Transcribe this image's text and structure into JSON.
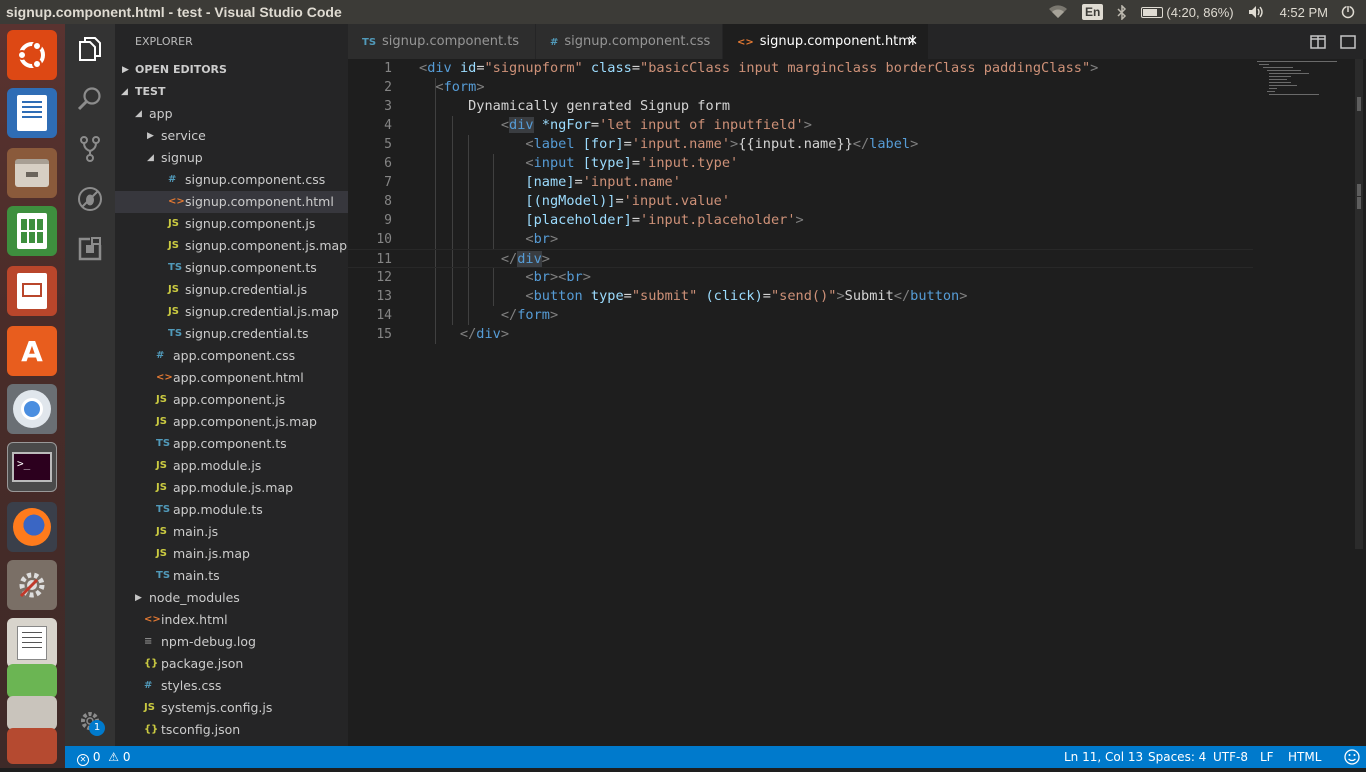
{
  "window": {
    "title": "signup.component.html - test - Visual Studio Code"
  },
  "tray": {
    "lang": "En",
    "battery": "(4:20, 86%)",
    "clock": "4:52 PM"
  },
  "sidebar": {
    "title": "EXPLORER",
    "open_editors": "OPEN EDITORS",
    "project": "TEST",
    "tree": [
      {
        "name": "app",
        "type": "folder-open",
        "depth": 1
      },
      {
        "name": "service",
        "type": "folder",
        "depth": 2
      },
      {
        "name": "signup",
        "type": "folder-open",
        "depth": 2
      },
      {
        "name": "signup.component.css",
        "type": "css",
        "depth": 3
      },
      {
        "name": "signup.component.html",
        "type": "html",
        "depth": 3,
        "selected": true
      },
      {
        "name": "signup.component.js",
        "type": "js",
        "depth": 3
      },
      {
        "name": "signup.component.js.map",
        "type": "js",
        "depth": 3
      },
      {
        "name": "signup.component.ts",
        "type": "ts",
        "depth": 3
      },
      {
        "name": "signup.credential.js",
        "type": "js",
        "depth": 3
      },
      {
        "name": "signup.credential.js.map",
        "type": "js",
        "depth": 3
      },
      {
        "name": "signup.credential.ts",
        "type": "ts",
        "depth": 3
      },
      {
        "name": "app.component.css",
        "type": "css",
        "depth": 2
      },
      {
        "name": "app.component.html",
        "type": "html",
        "depth": 2
      },
      {
        "name": "app.component.js",
        "type": "js",
        "depth": 2
      },
      {
        "name": "app.component.js.map",
        "type": "js",
        "depth": 2
      },
      {
        "name": "app.component.ts",
        "type": "ts",
        "depth": 2
      },
      {
        "name": "app.module.js",
        "type": "js",
        "depth": 2
      },
      {
        "name": "app.module.js.map",
        "type": "js",
        "depth": 2
      },
      {
        "name": "app.module.ts",
        "type": "ts",
        "depth": 2
      },
      {
        "name": "main.js",
        "type": "js",
        "depth": 2
      },
      {
        "name": "main.js.map",
        "type": "js",
        "depth": 2
      },
      {
        "name": "main.ts",
        "type": "ts",
        "depth": 2
      },
      {
        "name": "node_modules",
        "type": "folder",
        "depth": 1
      },
      {
        "name": "index.html",
        "type": "html",
        "depth": 1
      },
      {
        "name": "npm-debug.log",
        "type": "log",
        "depth": 1
      },
      {
        "name": "package.json",
        "type": "json",
        "depth": 1
      },
      {
        "name": "styles.css",
        "type": "css",
        "depth": 1
      },
      {
        "name": "systemjs.config.js",
        "type": "js",
        "depth": 1
      },
      {
        "name": "tsconfig.json",
        "type": "json",
        "depth": 1
      }
    ]
  },
  "tabs": [
    {
      "label": "signup.component.ts",
      "type": "ts",
      "active": false
    },
    {
      "label": "signup.component.css",
      "type": "css",
      "active": false
    },
    {
      "label": "signup.component.html",
      "type": "html",
      "active": true
    }
  ],
  "editor": {
    "current_line": 11,
    "lines": [
      [
        [
          "t-br",
          "<"
        ],
        [
          "t-tag",
          "div"
        ],
        [
          "t-txt",
          " "
        ],
        [
          "t-attr",
          "id"
        ],
        [
          "t-txt",
          "="
        ],
        [
          "t-str",
          "\"signupform\""
        ],
        [
          "t-txt",
          " "
        ],
        [
          "t-attr",
          "class"
        ],
        [
          "t-txt",
          "="
        ],
        [
          "t-str",
          "\"basicClass input marginclass borderClass paddingClass\""
        ],
        [
          "t-br",
          ">"
        ]
      ],
      [
        [
          "t-txt",
          "  "
        ],
        [
          "t-br",
          "<"
        ],
        [
          "t-tag",
          "form"
        ],
        [
          "t-br",
          ">"
        ]
      ],
      [
        [
          "t-txt",
          "      Dynamically genrated Signup form"
        ]
      ],
      [
        [
          "t-txt",
          "          "
        ],
        [
          "t-br",
          "<"
        ],
        [
          "t-tag hl",
          "div"
        ],
        [
          "t-txt",
          " "
        ],
        [
          "t-attr",
          "*ngFor"
        ],
        [
          "t-txt",
          "="
        ],
        [
          "t-str",
          "'let input of inputfield'"
        ],
        [
          "t-br",
          ">"
        ]
      ],
      [
        [
          "t-txt",
          "             "
        ],
        [
          "t-br",
          "<"
        ],
        [
          "t-tag",
          "label"
        ],
        [
          "t-txt",
          " "
        ],
        [
          "t-attr",
          "[for]"
        ],
        [
          "t-txt",
          "="
        ],
        [
          "t-str",
          "'input.name'"
        ],
        [
          "t-br",
          ">"
        ],
        [
          "t-txt",
          "{{input.name}}"
        ],
        [
          "t-br",
          "</"
        ],
        [
          "t-tag",
          "label"
        ],
        [
          "t-br",
          ">"
        ]
      ],
      [
        [
          "t-txt",
          "             "
        ],
        [
          "t-br",
          "<"
        ],
        [
          "t-tag",
          "input"
        ],
        [
          "t-txt",
          " "
        ],
        [
          "t-attr",
          "[type]"
        ],
        [
          "t-txt",
          "="
        ],
        [
          "t-str",
          "'input.type'"
        ]
      ],
      [
        [
          "t-txt",
          "             "
        ],
        [
          "t-attr",
          "[name]"
        ],
        [
          "t-txt",
          "="
        ],
        [
          "t-str",
          "'input.name'"
        ]
      ],
      [
        [
          "t-txt",
          "             "
        ],
        [
          "t-attr",
          "[(ngModel)]"
        ],
        [
          "t-txt",
          "="
        ],
        [
          "t-str",
          "'input.value'"
        ]
      ],
      [
        [
          "t-txt",
          "             "
        ],
        [
          "t-attr",
          "[placeholder]"
        ],
        [
          "t-txt",
          "="
        ],
        [
          "t-str",
          "'input.placeholder'"
        ],
        [
          "t-br",
          ">"
        ]
      ],
      [
        [
          "t-txt",
          "             "
        ],
        [
          "t-br",
          "<"
        ],
        [
          "t-tag",
          "br"
        ],
        [
          "t-br",
          ">"
        ]
      ],
      [
        [
          "t-txt",
          "          "
        ],
        [
          "t-br",
          "</"
        ],
        [
          "t-tag hl",
          "div"
        ],
        [
          "t-br",
          ">"
        ]
      ],
      [
        [
          "t-txt",
          "             "
        ],
        [
          "t-br",
          "<"
        ],
        [
          "t-tag",
          "br"
        ],
        [
          "t-br",
          "><"
        ],
        [
          "t-tag",
          "br"
        ],
        [
          "t-br",
          ">"
        ]
      ],
      [
        [
          "t-txt",
          "             "
        ],
        [
          "t-br",
          "<"
        ],
        [
          "t-tag",
          "button"
        ],
        [
          "t-txt",
          " "
        ],
        [
          "t-attr",
          "type"
        ],
        [
          "t-txt",
          "="
        ],
        [
          "t-str",
          "\"submit\""
        ],
        [
          "t-txt",
          " "
        ],
        [
          "t-attr",
          "(click)"
        ],
        [
          "t-txt",
          "="
        ],
        [
          "t-str",
          "\"send()\""
        ],
        [
          "t-br",
          ">"
        ],
        [
          "t-txt",
          "Submit"
        ],
        [
          "t-br",
          "</"
        ],
        [
          "t-tag",
          "button"
        ],
        [
          "t-br",
          ">"
        ]
      ],
      [
        [
          "t-txt",
          "          "
        ],
        [
          "t-br",
          "</"
        ],
        [
          "t-tag",
          "form"
        ],
        [
          "t-br",
          ">"
        ]
      ],
      [
        [
          "t-txt",
          "     "
        ],
        [
          "t-br",
          "</"
        ],
        [
          "t-tag",
          "div"
        ],
        [
          "t-br",
          ">"
        ]
      ]
    ]
  },
  "statusbar": {
    "errors": "0",
    "warnings": "0",
    "position": "Ln 11, Col 13",
    "spaces": "Spaces: 4",
    "encoding": "UTF-8",
    "eol": "LF",
    "language": "HTML"
  },
  "activity_bar": {
    "badge": "1"
  },
  "icons": {
    "explorer": "files-icon",
    "search": "search-icon",
    "scm": "source-control-icon",
    "debug": "debug-icon",
    "extensions": "extensions-icon",
    "settings": "gear-icon"
  },
  "colors": {
    "accent": "#007acc",
    "editor_bg": "#1e1e1e",
    "sidebar_bg": "#252526"
  }
}
